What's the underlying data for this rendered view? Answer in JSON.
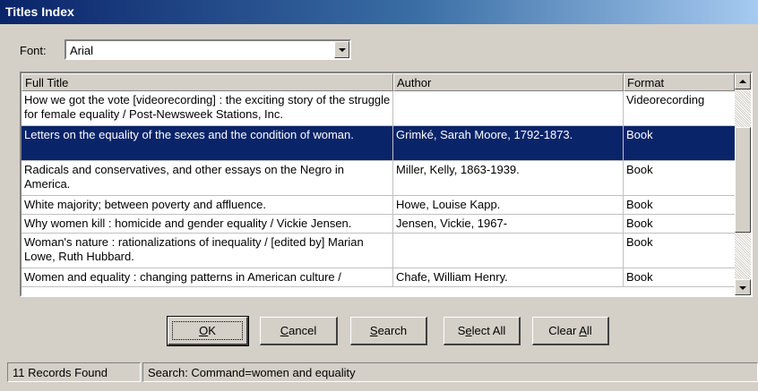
{
  "window": {
    "title": "Titles Index"
  },
  "font": {
    "label": "Font:",
    "value": "Arial"
  },
  "table": {
    "columns": [
      "Full Title",
      "Author",
      "Format"
    ],
    "rows": [
      {
        "title": "How we got the vote [videorecording] : the exciting story of the struggle for female equality / Post-Newsweek Stations, Inc.",
        "author": "",
        "format": "Videorecording",
        "selected": false
      },
      {
        "title": "Letters on the equality of the sexes and the condition of woman.",
        "author": "Grimké, Sarah Moore, 1792-1873.",
        "format": "Book",
        "selected": true
      },
      {
        "title": "Radicals and conservatives, and other essays on the Negro in America.",
        "author": "Miller, Kelly, 1863-1939.",
        "format": "Book",
        "selected": false
      },
      {
        "title": "White majority; between poverty and affluence.",
        "author": "Howe, Louise Kapp.",
        "format": "Book",
        "selected": false
      },
      {
        "title": "Why women kill : homicide and gender equality / Vickie Jensen.",
        "author": "Jensen, Vickie, 1967-",
        "format": "Book",
        "selected": false
      },
      {
        "title": "Woman's nature : rationalizations of inequality / [edited by] Marian Lowe, Ruth Hubbard.",
        "author": "",
        "format": "Book",
        "selected": false
      },
      {
        "title": "Women and equality : changing patterns in American culture /",
        "author": "Chafe, William Henry.",
        "format": "Book",
        "selected": false
      }
    ]
  },
  "buttons": {
    "ok": {
      "pre": "",
      "key": "O",
      "post": "K"
    },
    "cancel": {
      "pre": "",
      "key": "C",
      "post": "ancel"
    },
    "search": {
      "pre": "",
      "key": "S",
      "post": "earch"
    },
    "select_all": {
      "pre": "S",
      "key": "e",
      "post": "lect All"
    },
    "clear_all": {
      "pre": "Clear ",
      "key": "A",
      "post": "ll"
    }
  },
  "status": {
    "records": "11 Records Found",
    "search": "Search: Command=women and equality"
  },
  "colors": {
    "selection": "#0a246a",
    "titlebar_start": "#0a246a",
    "face": "#d4d0c8"
  }
}
